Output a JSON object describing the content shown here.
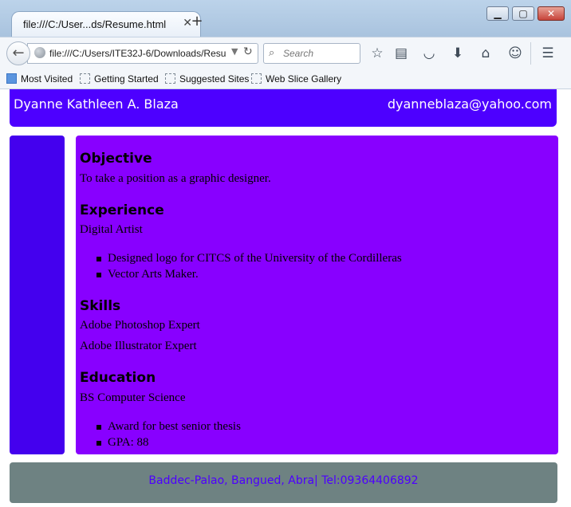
{
  "browser": {
    "tab_title": "file:///C:/User...ds/Resume.html",
    "url": "file:///C:/Users/ITE32J-6/Downloads/Resu",
    "search_placeholder": "Search",
    "bookmarks": [
      "Most Visited",
      "Getting Started",
      "Suggested Sites",
      "Web Slice Gallery"
    ]
  },
  "page": {
    "header": {
      "name": "Dyanne Kathleen A. Blaza",
      "email": "dyanneblaza@yahoo.com"
    },
    "objective": {
      "heading": "Objective",
      "text": "To take a position as a graphic designer."
    },
    "experience": {
      "heading": "Experience",
      "role": "Digital Artist",
      "items": [
        "Designed logo for CITCS of the University of the Cordilleras",
        "Vector Arts Maker."
      ]
    },
    "skills": {
      "heading": "Skills",
      "items": [
        "Adobe Photoshop Expert",
        "Adobe Illustrator Expert"
      ]
    },
    "education": {
      "heading": "Education",
      "degree": "BS Computer Science",
      "items": [
        "Award for best senior thesis",
        "GPA: 88"
      ]
    },
    "footer": "Baddec-Palao, Bangued, Abra| Tel:09364406892"
  },
  "colors": {
    "header_bg": "#4d00ff",
    "sidebar_bg": "#4400ee",
    "main_bg": "#8800ff",
    "footer_bg": "#6e8282",
    "footer_text": "#4d00ff"
  }
}
